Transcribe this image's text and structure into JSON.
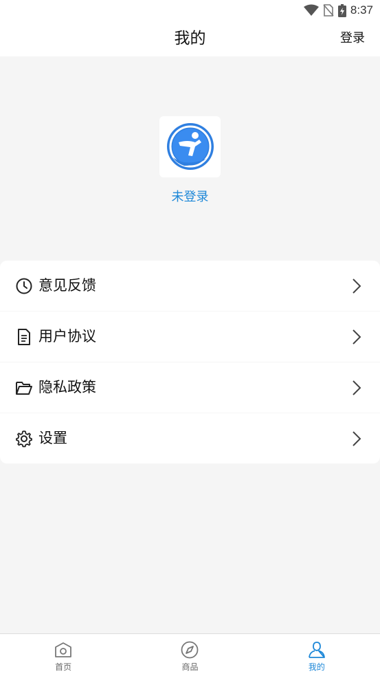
{
  "status_bar": {
    "time": "8:37"
  },
  "header": {
    "title": "我的",
    "login_label": "登录"
  },
  "profile": {
    "status": "未登录"
  },
  "menu": {
    "items": [
      {
        "label": "意见反馈",
        "icon": "clock-icon"
      },
      {
        "label": "用户协议",
        "icon": "document-icon"
      },
      {
        "label": "隐私政策",
        "icon": "folder-icon"
      },
      {
        "label": "设置",
        "icon": "gear-icon"
      }
    ]
  },
  "tabbar": {
    "tabs": [
      {
        "label": "首页",
        "icon": "home-icon",
        "active": false
      },
      {
        "label": "商品",
        "icon": "compass-icon",
        "active": false
      },
      {
        "label": "我的",
        "icon": "user-icon",
        "active": true
      }
    ]
  },
  "colors": {
    "accent": "#1e88d8",
    "background": "#f5f5f5"
  }
}
